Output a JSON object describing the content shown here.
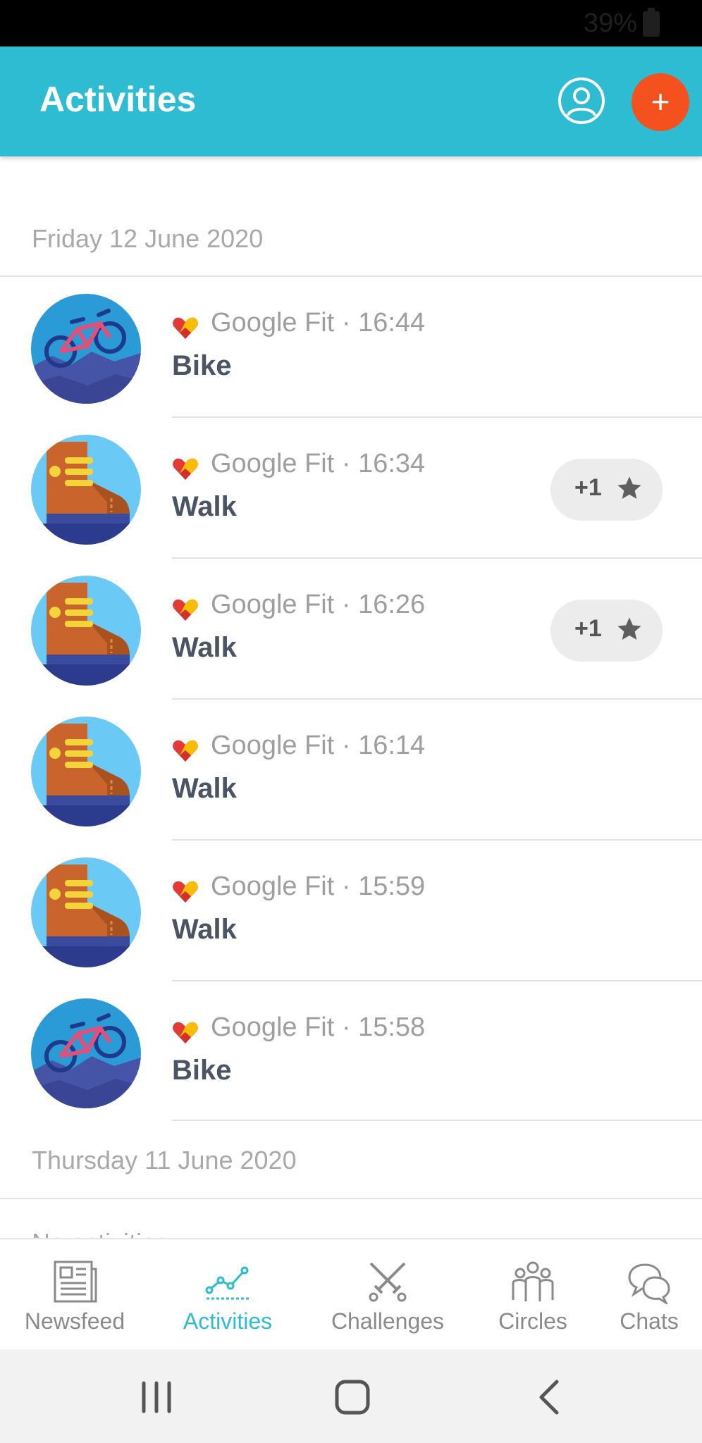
{
  "status_bar": {
    "battery_text": "39%"
  },
  "header": {
    "title": "Activities",
    "add_label": "+"
  },
  "sections": [
    {
      "date": "Friday 12 June 2020",
      "activities": [
        {
          "source": "Google Fit",
          "time": "16:44",
          "source_line": "Google Fit · 16:44",
          "type": "Bike",
          "kudos": null,
          "icon": "bike-icon"
        },
        {
          "source": "Google Fit",
          "time": "16:34",
          "source_line": "Google Fit · 16:34",
          "type": "Walk",
          "kudos": "+1",
          "icon": "boot-icon"
        },
        {
          "source": "Google Fit",
          "time": "16:26",
          "source_line": "Google Fit · 16:26",
          "type": "Walk",
          "kudos": "+1",
          "icon": "boot-icon"
        },
        {
          "source": "Google Fit",
          "time": "16:14",
          "source_line": "Google Fit · 16:14",
          "type": "Walk",
          "kudos": null,
          "icon": "boot-icon"
        },
        {
          "source": "Google Fit",
          "time": "15:59",
          "source_line": "Google Fit · 15:59",
          "type": "Walk",
          "kudos": null,
          "icon": "boot-icon"
        },
        {
          "source": "Google Fit",
          "time": "15:58",
          "source_line": "Google Fit · 15:58",
          "type": "Bike",
          "kudos": null,
          "icon": "bike-icon"
        }
      ]
    },
    {
      "date": "Thursday 11 June 2020",
      "partial_text": "No activities"
    }
  ],
  "bottom_nav": [
    {
      "label": "Newsfeed",
      "icon": "newspaper-icon",
      "active": false
    },
    {
      "label": "Activities",
      "icon": "activity-graph-icon",
      "active": true
    },
    {
      "label": "Challenges",
      "icon": "crossed-swords-icon",
      "active": false
    },
    {
      "label": "Circles",
      "icon": "group-icon",
      "active": false
    },
    {
      "label": "Chats",
      "icon": "chat-bubbles-icon",
      "active": false
    }
  ],
  "colors": {
    "header_bg": "#2ebcd3",
    "add_button": "#f4511e",
    "active_tab": "#2ebcd3",
    "date_text": "#a9a9a9",
    "activity_text": "#4a5464",
    "kudos_chip_bg": "#ececec"
  }
}
